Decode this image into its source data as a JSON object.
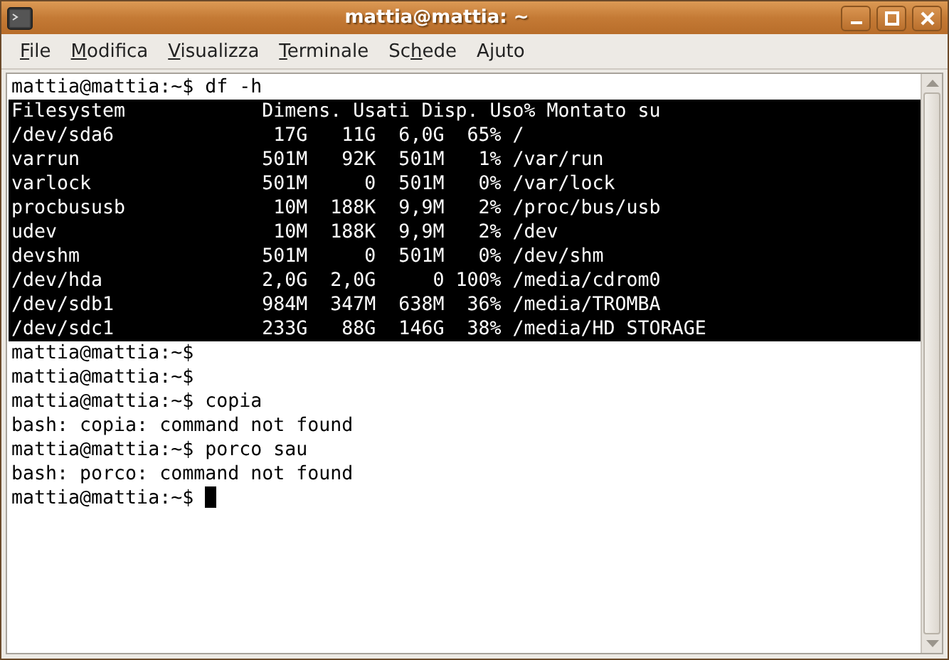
{
  "window": {
    "title": "mattia@mattia: ~"
  },
  "menu": [
    {
      "key": "F",
      "after": "ile"
    },
    {
      "key": "M",
      "after": "odifica"
    },
    {
      "key": "V",
      "after": "isualizza"
    },
    {
      "key": "T",
      "after": "erminale"
    },
    {
      "before": "Sc",
      "key": "h",
      "after": "ede"
    },
    {
      "before": "A",
      "key": "j",
      "after": "uto"
    }
  ],
  "terminal": {
    "cursor": true,
    "lines": [
      {
        "text": "mattia@mattia:~$ df -h",
        "selected": false
      },
      {
        "text": "Filesystem            Dimens. Usati Disp. Uso% Montato su",
        "selected": true
      },
      {
        "text": "/dev/sda6              17G   11G  6,0G  65% /",
        "selected": true
      },
      {
        "text": "varrun                501M   92K  501M   1% /var/run",
        "selected": true
      },
      {
        "text": "varlock               501M     0  501M   0% /var/lock",
        "selected": true
      },
      {
        "text": "procbususb             10M  188K  9,9M   2% /proc/bus/usb",
        "selected": true
      },
      {
        "text": "udev                   10M  188K  9,9M   2% /dev",
        "selected": true
      },
      {
        "text": "devshm                501M     0  501M   0% /dev/shm",
        "selected": true
      },
      {
        "text": "/dev/hda              2,0G  2,0G     0 100% /media/cdrom0",
        "selected": true
      },
      {
        "text": "/dev/sdb1             984M  347M  638M  36% /media/TROMBA",
        "selected": true
      },
      {
        "text": "/dev/sdc1             233G   88G  146G  38% /media/HD STORAGE",
        "selected": true
      },
      {
        "text": "mattia@mattia:~$",
        "selected": false
      },
      {
        "text": "mattia@mattia:~$",
        "selected": false
      },
      {
        "text": "mattia@mattia:~$ copia",
        "selected": false
      },
      {
        "text": "bash: copia: command not found",
        "selected": false
      },
      {
        "text": "mattia@mattia:~$ porco sau",
        "selected": false
      },
      {
        "text": "bash: porco: command not found",
        "selected": false
      },
      {
        "text": "mattia@mattia:~$",
        "selected": false
      }
    ]
  }
}
